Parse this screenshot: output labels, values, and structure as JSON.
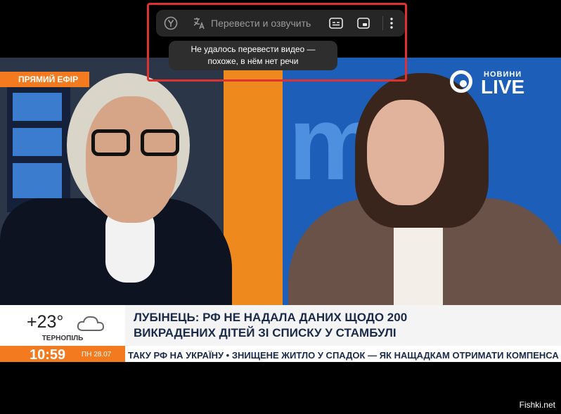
{
  "toolbar": {
    "translate_label": "Перевести и озвучить",
    "tooltip_line1": "Не удалось перевести видео —",
    "tooltip_line2": "похоже, в нём нет речи",
    "icons": [
      "yandex-logo-icon",
      "translate-icon",
      "subtitles-icon",
      "picture-in-picture-icon",
      "more-vertical-icon"
    ]
  },
  "video": {
    "live_badge": "ПРЯМИЙ ЕФІР",
    "channel_small": "НОВИНИ",
    "channel_big": "LIVE",
    "temperature": "+23°",
    "city": "ТЕРНОПІЛЬ",
    "clock": "10:59",
    "date": "ПН 28.07",
    "headline_line1": "ЛУБІНЕЦЬ: РФ НЕ НАДАЛА ДАНИХ ЩОДО 200",
    "headline_line2": "ВИКРАДЕНИХ ДІТЕЙ ЗІ СПИСКУ У СТАМБУЛІ",
    "ticker": "ТАКУ РФ НА УКРАЇНУ • ЗНИЩЕНЕ ЖИТЛО У СПАДОК — ЯК НАЩАДКАМ ОТРИМАТИ КОМПЕНСА"
  },
  "watermark": "Fishki.net",
  "colors": {
    "accent_orange": "#f47a20",
    "highlight_red": "#e03131",
    "toolbar_bg": "#262626"
  }
}
